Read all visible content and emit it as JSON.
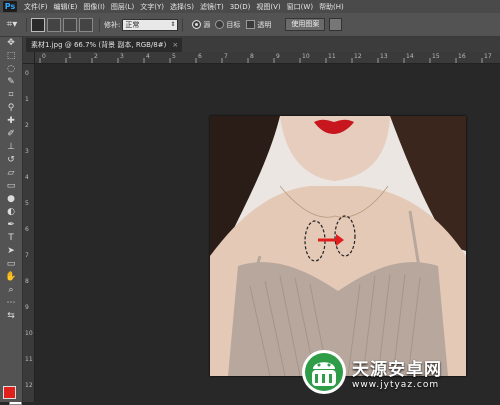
{
  "app": {
    "logo": "Ps"
  },
  "menu": [
    "文件(F)",
    "编辑(E)",
    "图像(I)",
    "图层(L)",
    "文字(Y)",
    "选择(S)",
    "滤镜(T)",
    "3D(D)",
    "视图(V)",
    "窗口(W)",
    "帮助(H)"
  ],
  "options": {
    "tool_icon": "patch-tool-icon",
    "patch_label": "修补:",
    "patch_mode": "正常",
    "source_label": "源",
    "dest_label": "目标",
    "transparent_label": "透明",
    "use_pattern_label": "使用图案"
  },
  "document": {
    "tab_title": "素材1.jpg @ 66.7% (背景 副本, RGB/8#)",
    "tab_close": "×"
  },
  "ruler": {
    "h_labels": [
      "0",
      "1",
      "2",
      "3",
      "4",
      "5",
      "6",
      "7",
      "8",
      "9",
      "10",
      "11",
      "12",
      "13",
      "14",
      "15",
      "16",
      "17"
    ],
    "v_labels": [
      "0",
      "1",
      "2",
      "3",
      "4",
      "5",
      "6",
      "7",
      "8",
      "9",
      "10",
      "11",
      "12"
    ]
  },
  "colors": {
    "foreground": "#e0201a",
    "background": "#ffffff"
  },
  "watermark": {
    "title": "天源安卓网",
    "url": "www.jytyaz.com"
  }
}
